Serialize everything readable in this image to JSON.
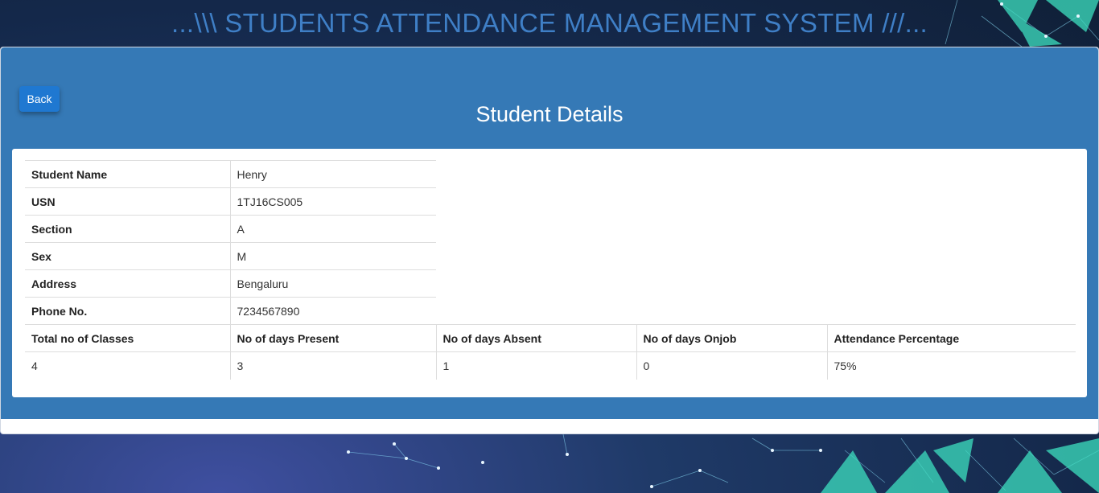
{
  "header": {
    "app_title": "...\\\\\\ STUDENTS ATTENDANCE MANAGEMENT SYSTEM ///..."
  },
  "page": {
    "back_label": "Back",
    "title": "Student Details"
  },
  "student": {
    "name_label": "Student Name",
    "name": "Henry",
    "usn_label": "USN",
    "usn": "1TJ16CS005",
    "section_label": "Section",
    "section": "A",
    "sex_label": "Sex",
    "sex": "M",
    "address_label": "Address",
    "address": "Bengaluru",
    "phone_label": "Phone No.",
    "phone": "7234567890"
  },
  "attendance": {
    "headers": [
      "Total no of Classes",
      "No of days Present",
      "No of days Absent",
      "No of days Onjob",
      "Attendance Percentage"
    ],
    "values": [
      "4",
      "3",
      "1",
      "0",
      "75%"
    ]
  },
  "colors": {
    "card": "#3579b6",
    "button": "#1f78d1",
    "title_text": "#3f7fc6",
    "accent_network": "#3de0c0"
  }
}
